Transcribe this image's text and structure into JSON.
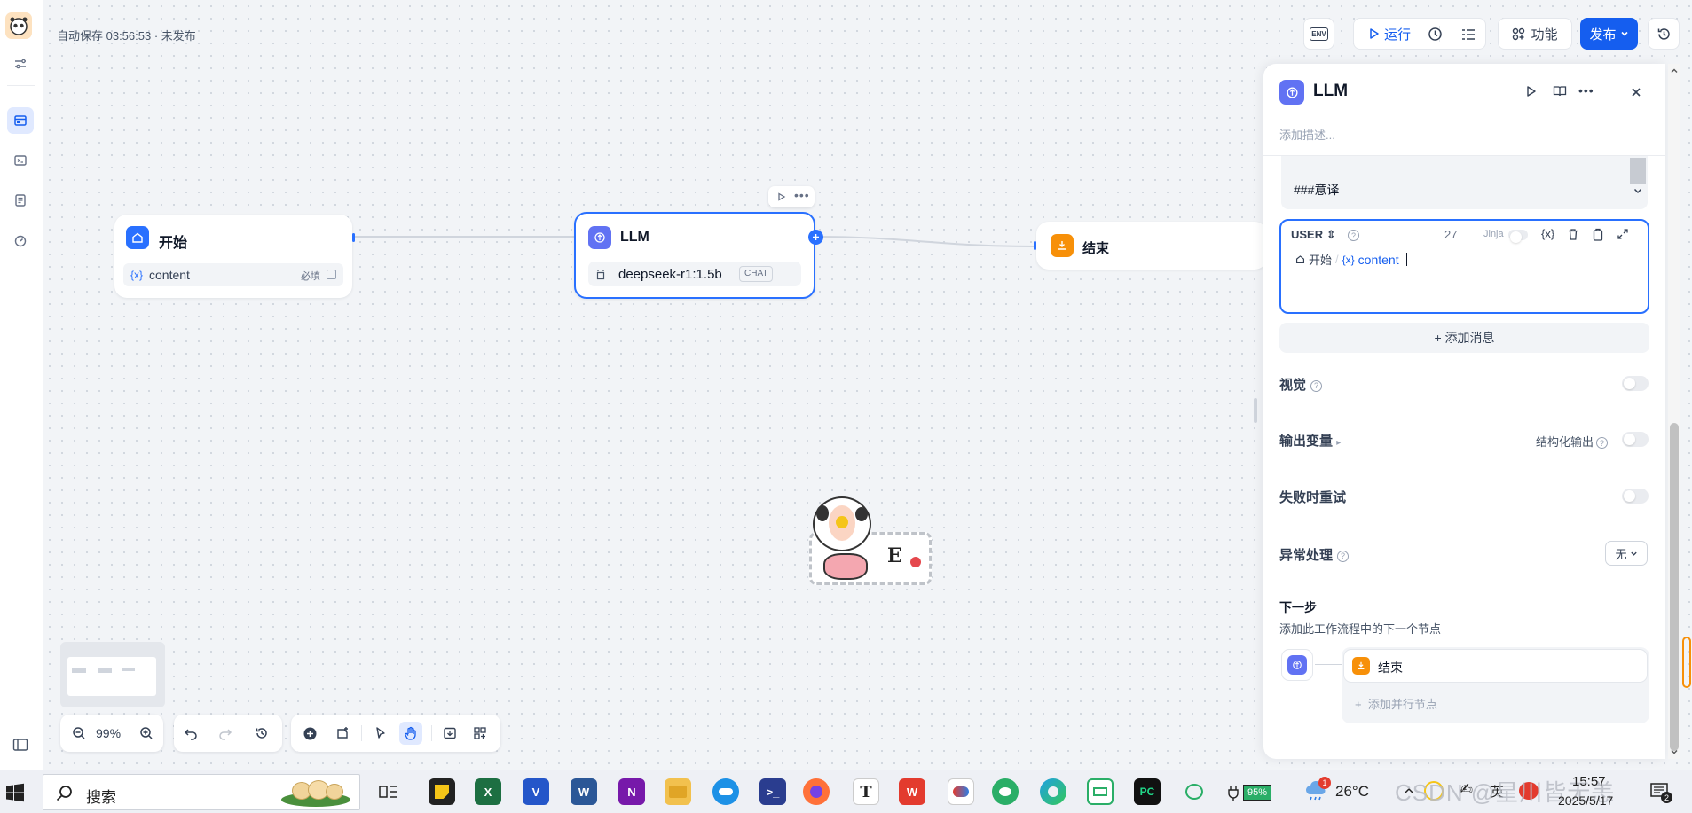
{
  "canvas": {
    "save_status": "自动保存 03:56:53 · 未发布",
    "zoom": "99%"
  },
  "toolbar": {
    "env_label": "ENV",
    "run_label": "运行",
    "features_label": "功能",
    "publish_label": "发布"
  },
  "nodes": {
    "start": {
      "title": "开始",
      "var_prefix": "{x}",
      "var_name": "content",
      "required": "必填"
    },
    "llm": {
      "title": "LLM",
      "model": "deepseek-r1:1.5b",
      "mode": "CHAT"
    },
    "end": {
      "title": "结束"
    }
  },
  "sticker": {
    "letter": "E"
  },
  "panel": {
    "title": "LLM",
    "desc_placeholder": "添加描述...",
    "system_prompt_text": "###意译",
    "user_role": "USER",
    "token_count": "27",
    "jinja_label": "Jinja",
    "var_btn": "{x}",
    "prompt_var": {
      "source": "开始",
      "separator": "/",
      "prefix": "{x}",
      "name": "content"
    },
    "add_message": "+ 添加消息",
    "vision_label": "视觉",
    "output_label": "输出变量",
    "structured_output_label": "结构化输出",
    "retry_label": "失败时重试",
    "error_label": "异常处理",
    "error_value": "无",
    "next_step_title": "下一步",
    "next_step_desc": "添加此工作流程中的下一个节点",
    "next_node_label": "结束",
    "add_parallel": "+  添加并行节点"
  },
  "taskbar": {
    "search_label": "搜索",
    "battery": "95%",
    "weather_badge": "1",
    "temperature": "26°C",
    "time": "15:57",
    "date": "2025/5/17",
    "watermark": "CSDN @星川皆无恙"
  },
  "colors": {
    "accent": "#155eef",
    "node_start": "#2970ff",
    "node_llm": "#6172f3",
    "node_end": "#f79009"
  }
}
